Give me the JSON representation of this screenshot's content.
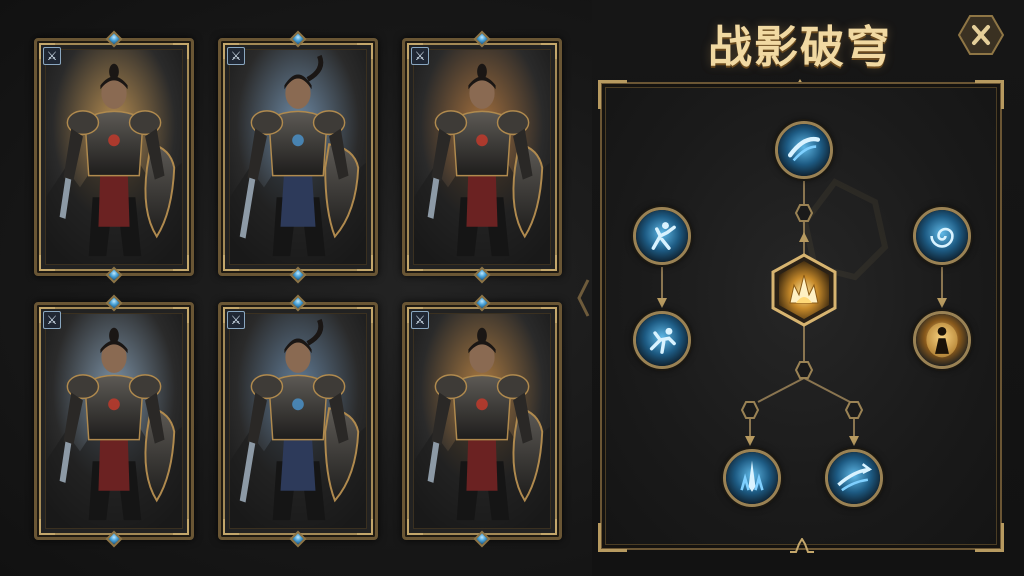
{
  "panel": {
    "title": "战影破穹"
  },
  "heroes": [
    {
      "id": "hero-1",
      "tone": "#b98f52",
      "class_icon": "⚔"
    },
    {
      "id": "hero-2",
      "tone": "#6f8ca8",
      "class_icon": "⚔"
    },
    {
      "id": "hero-3",
      "tone": "#a8723e",
      "class_icon": "⚔"
    },
    {
      "id": "hero-4",
      "tone": "#7e95aa",
      "class_icon": "⚔"
    },
    {
      "id": "hero-5",
      "tone": "#64809c",
      "class_icon": "⚔"
    },
    {
      "id": "hero-6",
      "tone": "#b07d42",
      "class_icon": "⚔"
    }
  ],
  "skills": {
    "core": {
      "icon": "golden-flame-icon",
      "color": "#f0c060"
    },
    "nodes": [
      {
        "name": "slash-wave-icon",
        "color": "#6fc4ef"
      },
      {
        "name": "dash-strike-icon",
        "color": "#6fc4ef"
      },
      {
        "name": "leap-attack-icon",
        "color": "#6fc4ef"
      },
      {
        "name": "vortex-icon",
        "color": "#6fc4ef"
      },
      {
        "name": "golden-aura-icon",
        "color": "#f0c060"
      },
      {
        "name": "ground-spike-icon",
        "color": "#6fc4ef"
      },
      {
        "name": "wind-sweep-icon",
        "color": "#6fc4ef"
      }
    ]
  },
  "colors": {
    "gold": "#c4a76b",
    "ice": "#6fc4ef"
  }
}
